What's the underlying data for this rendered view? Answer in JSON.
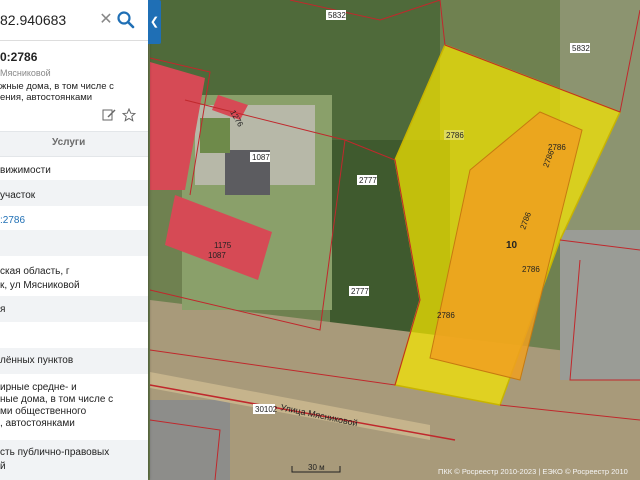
{
  "search": {
    "value": "82.940683",
    "clear_icon": "close-icon",
    "search_icon": "search-icon"
  },
  "collapse_icon": "chevron-left-icon",
  "info": {
    "cad_number": "0:2786",
    "address_short": "Мясниковой",
    "use_text_line1": "жные дома, в том числе с",
    "use_text_line2": "ения, автостоянками",
    "icons": [
      "edit-icon",
      "star-icon"
    ]
  },
  "tabs": {
    "services": "Услуги"
  },
  "rows": [
    {
      "text": "вижимости"
    },
    {
      "text": "участок"
    },
    {
      "text": ":2786"
    },
    {
      "text": ""
    },
    {
      "text": "ская область, г"
    },
    {
      "text": "к, ул Мясниковой"
    },
    {
      "text": "я"
    },
    {
      "text": ""
    },
    {
      "text": "лённых пунктов"
    },
    {
      "text": "ирные средне- и"
    },
    {
      "text": "ные дома, в том числе с"
    },
    {
      "text": "ми общественного"
    },
    {
      "text": ", автостоянками"
    },
    {
      "text": "сть публично-правовых"
    },
    {
      "text": "й"
    }
  ],
  "map": {
    "parcel_labels": [
      "5832",
      "5832",
      "2786",
      "2786",
      "2786",
      "2786",
      "2786",
      "2786",
      "10",
      "2777",
      "2777",
      "1087",
      "1087",
      "1175",
      "30102",
      "1276"
    ],
    "street_label": "Улица Мясниковой",
    "scale_label": "30 м",
    "attribution": "ПКК © Росреестр 2010-2023 | ЕЭКО © Росреестр 2010",
    "highlight_color": "#f5e600",
    "building_color": "#f0a020",
    "roof_color": "#d64a55"
  }
}
